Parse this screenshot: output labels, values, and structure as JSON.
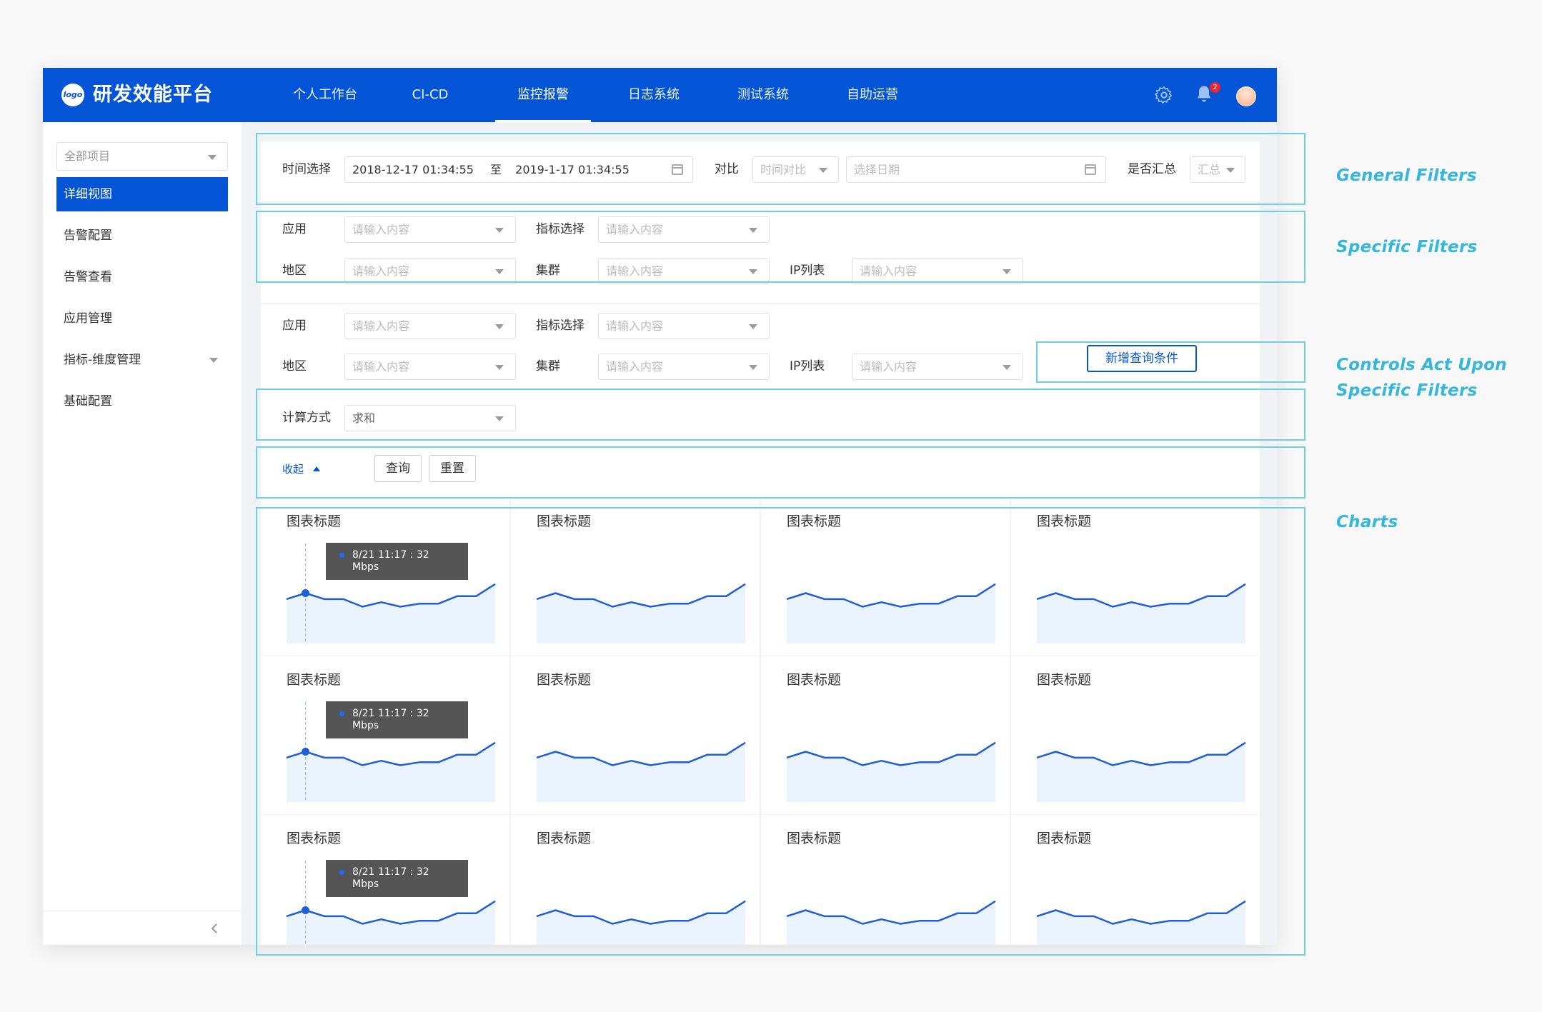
{
  "topbar": {
    "logo_text": "logo",
    "brand": "研发效能平台",
    "nav": [
      "个人工作台",
      "CI-CD",
      "监控报警",
      "日志系统",
      "测试系统",
      "自助运营"
    ],
    "active_nav": "监控报警",
    "notification_count": "2",
    "icons": [
      "gear-icon",
      "bell-icon",
      "avatar"
    ]
  },
  "sidebar": {
    "project_select": "全部项目",
    "items": [
      "详细视图",
      "告警配置",
      "告警查看",
      "应用管理",
      "指标-维度管理",
      "基础配置"
    ],
    "active_item": "详细视图"
  },
  "general_filters": {
    "time_label": "时间选择",
    "time_start": "2018-12-17 01:34:55",
    "time_to": "至",
    "time_end": "2019-1-17 01:34:55",
    "compare_label": "对比",
    "compare_select": "时间对比",
    "date_placeholder": "选择日期",
    "summary_label": "是否汇总",
    "summary_select": "汇总"
  },
  "specific_filters": [
    {
      "app_label": "应用",
      "app_placeholder": "请输入内容",
      "metric_label": "指标选择",
      "metric_placeholder": "请输入内容",
      "region_label": "地区",
      "region_placeholder": "请输入内容",
      "cluster_label": "集群",
      "cluster_placeholder": "请输入内容",
      "ip_label": "IP列表",
      "ip_placeholder": "请输入内容"
    },
    {
      "app_label": "应用",
      "app_placeholder": "请输入内容",
      "metric_label": "指标选择",
      "metric_placeholder": "请输入内容",
      "region_label": "地区",
      "region_placeholder": "请输入内容",
      "cluster_label": "集群",
      "cluster_placeholder": "请输入内容",
      "ip_label": "IP列表",
      "ip_placeholder": "请输入内容"
    }
  ],
  "add_condition_button": "新增查询条件",
  "calc": {
    "label": "计算方式",
    "value": "求和"
  },
  "actions": {
    "collapse": "收起",
    "query": "查询",
    "reset": "重置"
  },
  "charts": {
    "title": "图表标题",
    "tooltip_time": "8/21 11:17 : 32",
    "tooltip_unit": "Mbps"
  },
  "chart_data": {
    "type": "area",
    "title": "图表标题",
    "xlabel": "",
    "ylabel": "",
    "grid": false,
    "series": [
      {
        "values": [
          58,
          62,
          58,
          58,
          53,
          56,
          53,
          55,
          55,
          60,
          60,
          68
        ]
      }
    ]
  },
  "annotations": [
    "General Filters",
    "Specific Filters",
    "Controls Act Upon Specific Filters",
    "Charts"
  ],
  "colors": {
    "primary": "#0455d6",
    "annotation": "#36b6da",
    "line": "#1f5fd6",
    "area": "#eaf3fe"
  }
}
